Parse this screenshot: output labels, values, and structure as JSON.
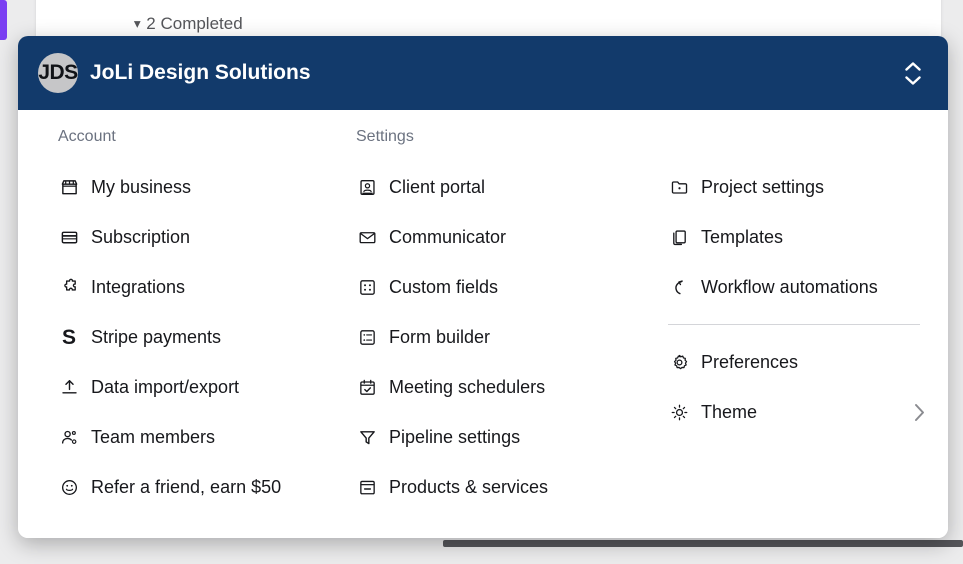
{
  "background": {
    "completed_label": "2 Completed",
    "caret": "▾",
    "chips": [
      {
        "color": "#e8889a"
      },
      {
        "color": "#0f7a48"
      }
    ]
  },
  "popover": {
    "header": {
      "avatar_initials": "JDS",
      "workspace_name": "JoLi Design Solutions",
      "switcher_icon": "expand-collapse-chevrons"
    },
    "columns": [
      {
        "title": "Account",
        "groups": [
          {
            "items": [
              {
                "icon": "storefront-icon",
                "label": "My business"
              },
              {
                "icon": "credit-card-icon",
                "label": "Subscription"
              },
              {
                "icon": "puzzle-piece-icon",
                "label": "Integrations"
              },
              {
                "icon": "stripe-s-icon",
                "label": "Stripe payments"
              },
              {
                "icon": "upload-arrow-icon",
                "label": "Data import/export"
              },
              {
                "icon": "person-gear-icon",
                "label": "Team members"
              },
              {
                "icon": "smiley-face-icon",
                "label": "Refer a friend, earn $50"
              }
            ]
          }
        ]
      },
      {
        "title": "Settings",
        "groups": [
          {
            "items": [
              {
                "icon": "client-portal-icon",
                "label": "Client portal"
              },
              {
                "icon": "envelope-icon",
                "label": "Communicator"
              },
              {
                "icon": "grid-dots-icon",
                "label": "Custom fields"
              },
              {
                "icon": "form-list-icon",
                "label": "Form builder"
              },
              {
                "icon": "calendar-check-icon",
                "label": "Meeting schedulers"
              },
              {
                "icon": "funnel-icon",
                "label": "Pipeline settings"
              },
              {
                "icon": "box-icon",
                "label": "Products & services"
              }
            ]
          }
        ]
      },
      {
        "title": "",
        "groups": [
          {
            "items": [
              {
                "icon": "folder-icon",
                "label": "Project settings"
              },
              {
                "icon": "copy-icon",
                "label": "Templates"
              },
              {
                "icon": "curved-arrow-icon",
                "label": "Workflow automations"
              }
            ]
          },
          {
            "divider": true,
            "items": [
              {
                "icon": "gear-icon",
                "label": "Preferences"
              },
              {
                "icon": "sun-icon",
                "label": "Theme",
                "chevron": "chevron-right-icon"
              }
            ]
          }
        ]
      }
    ]
  },
  "colors": {
    "header_navy": "#123a6b",
    "panel_white": "#ffffff",
    "text_primary": "#17181c",
    "text_muted": "#6b7280"
  }
}
